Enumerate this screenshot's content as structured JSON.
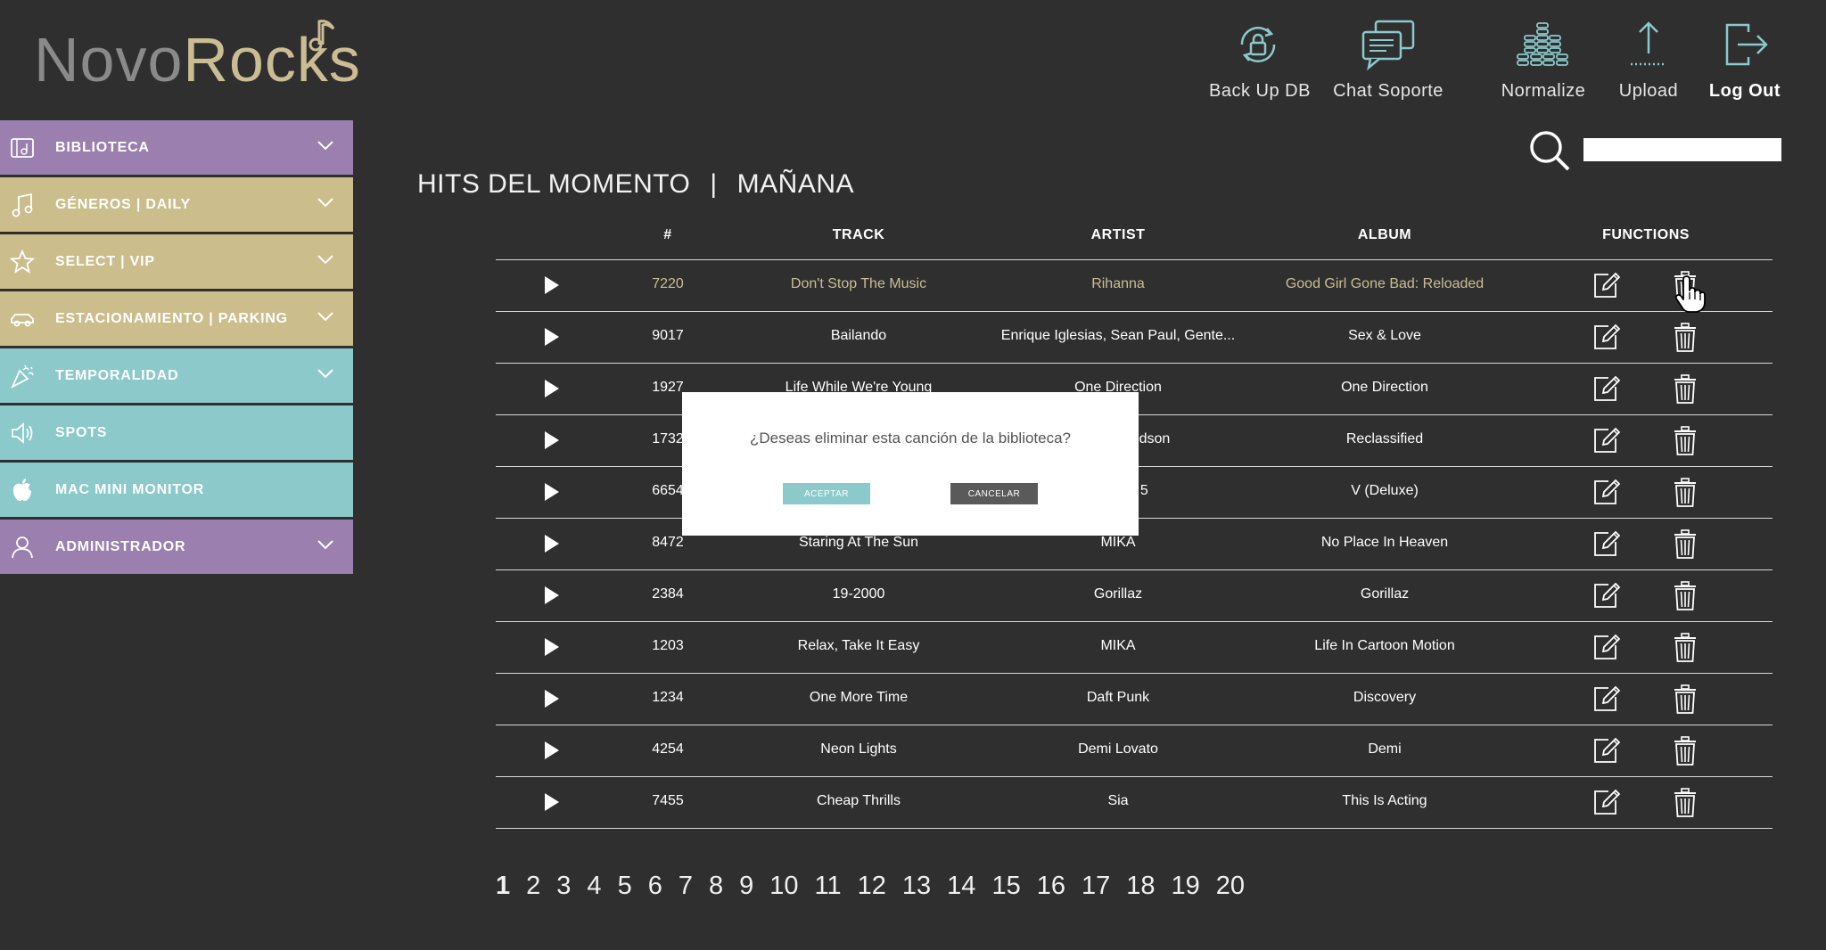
{
  "logo": {
    "part1": "Novo",
    "part2": "Rocks"
  },
  "toolbar": [
    {
      "label": "Back Up DB",
      "icon": "database-lock-icon"
    },
    {
      "label": "Chat Soporte",
      "icon": "chat-bubbles-icon"
    },
    {
      "label": "Normalize",
      "icon": "equalizer-icon"
    },
    {
      "label": "Upload",
      "icon": "upload-arrow-icon"
    },
    {
      "label": "Log Out",
      "icon": "logout-icon"
    }
  ],
  "sidebar": {
    "items": [
      {
        "label": "BIBLIOTECA",
        "color": "#9b7fae",
        "icon": "library-icon",
        "expandable": true
      },
      {
        "label": "GÉNEROS | DAILY",
        "color": "#cbbd8c",
        "icon": "music-note-icon",
        "expandable": true
      },
      {
        "label": "SELECT | VIP",
        "color": "#cbbd8c",
        "icon": "star-icon",
        "expandable": true
      },
      {
        "label": "ESTACIONAMIENTO | PARKING",
        "color": "#cbbd8c",
        "icon": "car-icon",
        "expandable": true
      },
      {
        "label": "TEMPORALIDAD",
        "color": "#8cc9cb",
        "icon": "confetti-icon",
        "expandable": true
      },
      {
        "label": "SPOTS",
        "color": "#8cc9cb",
        "icon": "speaker-icon",
        "expandable": false
      },
      {
        "label": "MAC MINI MONITOR",
        "color": "#8cc9cb",
        "icon": "apple-icon",
        "expandable": false
      },
      {
        "label": "ADMINISTRADOR",
        "color": "#9b7fae",
        "icon": "user-icon",
        "expandable": true
      }
    ]
  },
  "search": {
    "value": ""
  },
  "page": {
    "title": "HITS DEL MOMENTO",
    "separator": "|",
    "subtitle": "MAÑANA"
  },
  "table": {
    "headers": {
      "num": "#",
      "track": "TRACK",
      "artist": "ARTIST",
      "album": "ALBUM",
      "functions": "FUNCTIONS"
    },
    "rows": [
      {
        "num": "7220",
        "track": "Don't Stop The Music",
        "artist": "Rihanna",
        "album": "Good Girl Gone Bad: Reloaded",
        "active": true
      },
      {
        "num": "9017",
        "track": "Bailando",
        "artist": "Enrique Iglesias, Sean Paul, Gente...",
        "album": "Sex & Love"
      },
      {
        "num": "1927",
        "track": "Life While We're Young",
        "artist": "One Direction",
        "album": "One Direction"
      },
      {
        "num": "1732",
        "track": "",
        "artist": "Jennifer Hudson",
        "album": "Reclassified"
      },
      {
        "num": "6654",
        "track": "",
        "artist": "Maroon 5",
        "album": "V (Deluxe)"
      },
      {
        "num": "8472",
        "track": "Staring At The Sun",
        "artist": "MIKA",
        "album": "No Place In Heaven"
      },
      {
        "num": "2384",
        "track": "19-2000",
        "artist": "Gorillaz",
        "album": "Gorillaz"
      },
      {
        "num": "1203",
        "track": "Relax, Take It Easy",
        "artist": "MIKA",
        "album": "Life In Cartoon Motion"
      },
      {
        "num": "1234",
        "track": "One More Time",
        "artist": "Daft Punk",
        "album": "Discovery"
      },
      {
        "num": "4254",
        "track": "Neon Lights",
        "artist": "Demi Lovato",
        "album": "Demi"
      },
      {
        "num": "7455",
        "track": "Cheap Thrills",
        "artist": "Sia",
        "album": "This Is Acting"
      }
    ]
  },
  "pagination": {
    "current": "1",
    "pages": [
      "1",
      "2",
      "3",
      "4",
      "5",
      "6",
      "7",
      "8",
      "9",
      "10",
      "11",
      "12",
      "13",
      "14",
      "15",
      "16",
      "17",
      "18",
      "19",
      "20"
    ]
  },
  "modal": {
    "message": "¿Deseas eliminar esta canción de la biblioteca?",
    "accept_label": "ACEPTAR",
    "cancel_label": "CANCELAR"
  },
  "colors": {
    "background": "#2f2f2f",
    "purple": "#9b7fae",
    "tan": "#cbbd8c",
    "teal": "#8cc9cb",
    "accent_text": "#cbbd93"
  }
}
